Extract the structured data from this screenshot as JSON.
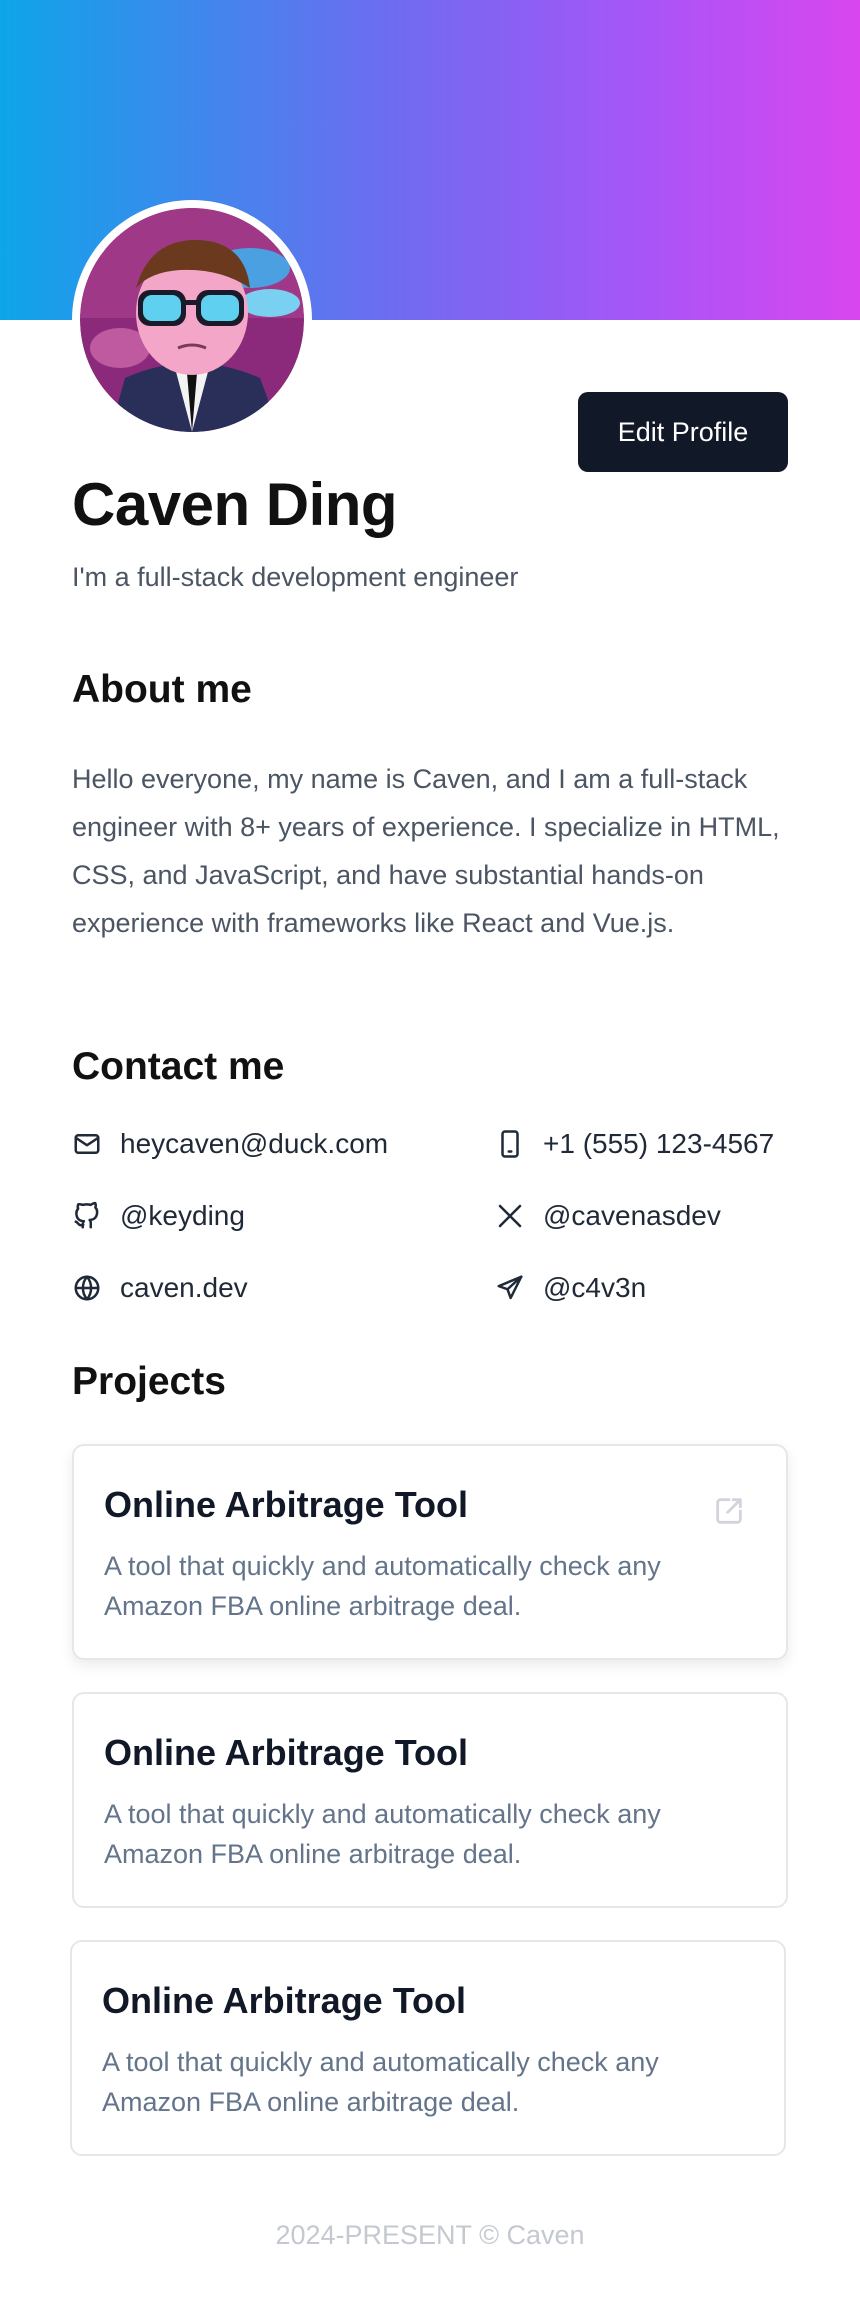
{
  "profile": {
    "name": "Caven Ding",
    "tagline": "I'm a full-stack development engineer",
    "edit_label": "Edit Profile"
  },
  "about": {
    "title": "About me",
    "text": "Hello everyone, my name is Caven, and I am a full-stack engineer with 8+ years of experience. I specialize in HTML, CSS, and JavaScript, and have substantial hands-on experience with frameworks like React and Vue.js."
  },
  "contact": {
    "title": "Contact me",
    "email": "heycaven@duck.com",
    "phone": "+1 (555) 123-4567",
    "github": "@keyding",
    "x": "@cavenasdev",
    "website": "caven.dev",
    "telegram": "@c4v3n"
  },
  "projects": {
    "title": "Projects",
    "items": [
      {
        "title": "Online Arbitrage Tool",
        "desc": "A tool that quickly and automatically check any Amazon FBA online arbitrage deal."
      },
      {
        "title": "Online Arbitrage Tool",
        "desc": "A tool that quickly and automatically check any Amazon FBA online arbitrage deal."
      },
      {
        "title": "Online Arbitrage Tool",
        "desc": "A tool that quickly and automatically check any Amazon FBA online arbitrage deal."
      }
    ]
  },
  "footer": {
    "text": "2024-PRESENT © Caven"
  },
  "colors": {
    "banner_start": "#0ea5e9",
    "banner_end": "#d946ef",
    "button_bg": "#111827"
  }
}
